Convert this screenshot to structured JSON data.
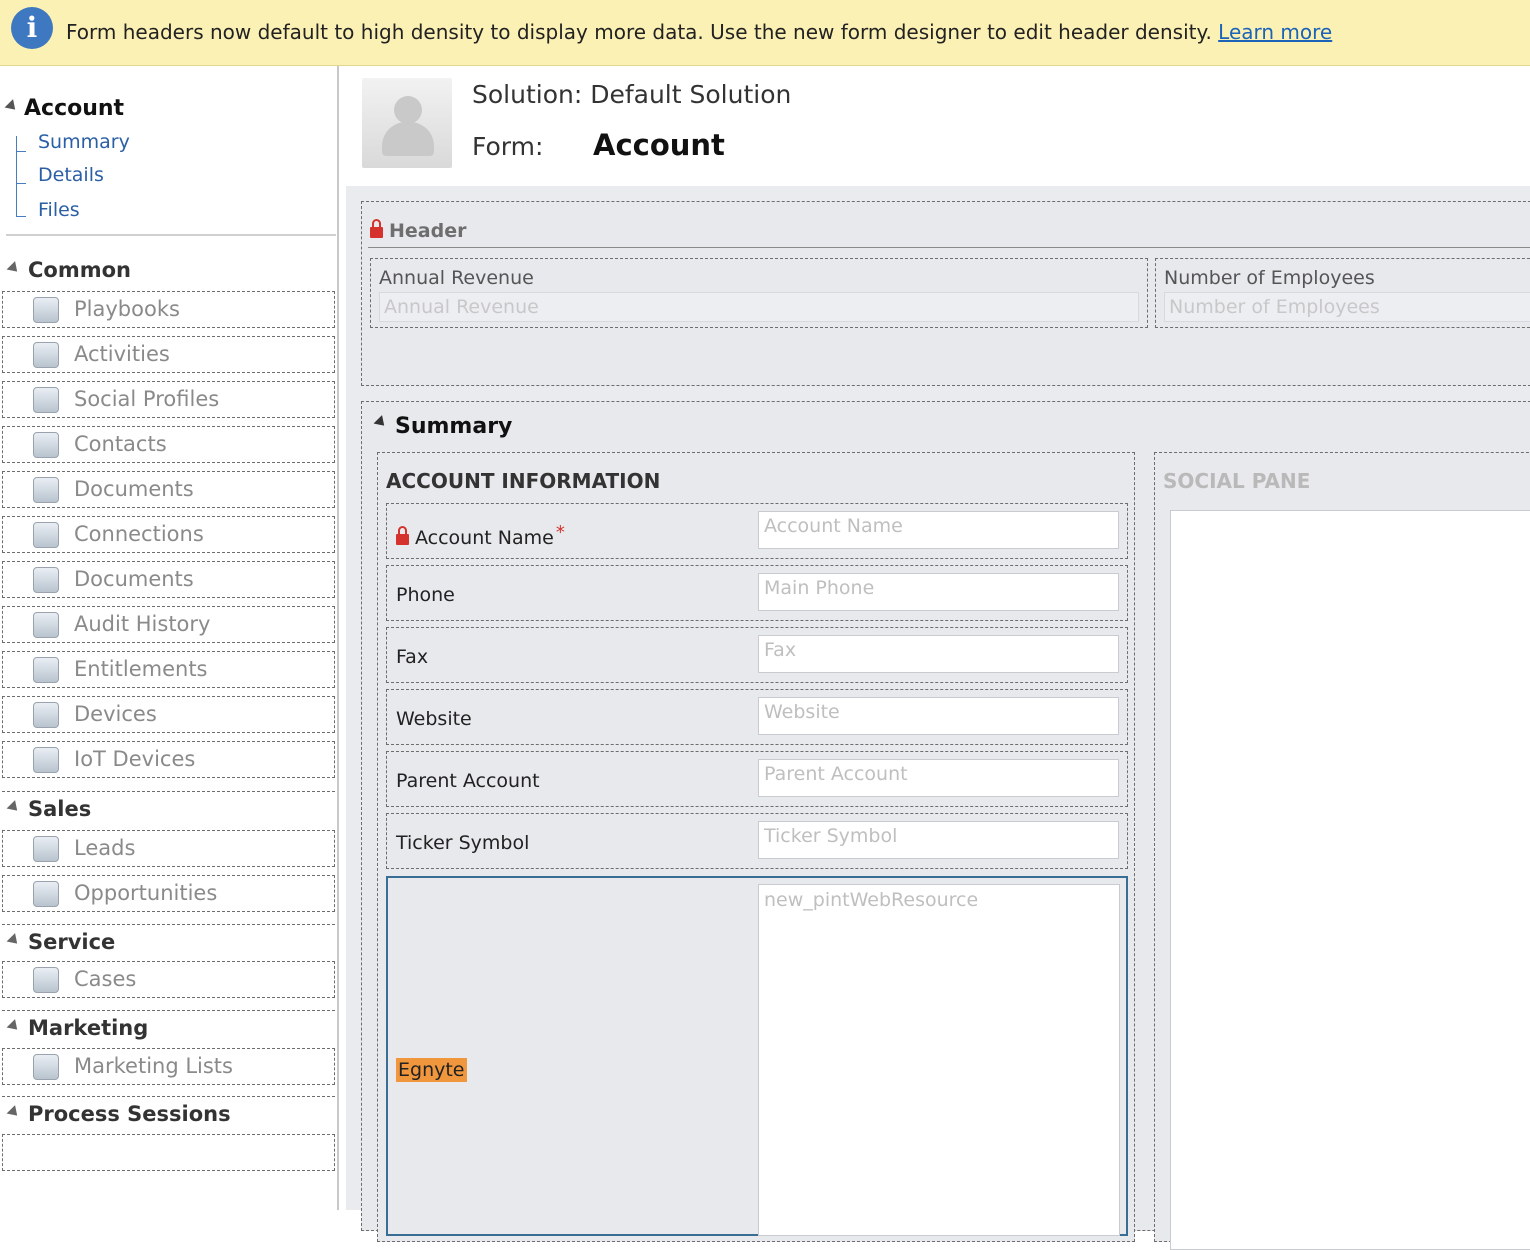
{
  "notification": {
    "message": "Form headers now default to high density to display more data. Use the new form designer to edit header density.",
    "link": "Learn more",
    "icon": "info-icon"
  },
  "sidebar": {
    "entity_title": "Account",
    "entity_links": [
      "Summary",
      "Details",
      "Files"
    ],
    "groups": [
      {
        "title": "Common",
        "items": [
          "Playbooks",
          "Activities",
          "Social Profiles",
          "Contacts",
          "Documents",
          "Connections",
          "Documents",
          "Audit History",
          "Entitlements",
          "Devices",
          "IoT Devices"
        ]
      },
      {
        "title": "Sales",
        "items": [
          "Leads",
          "Opportunities"
        ]
      },
      {
        "title": "Service",
        "items": [
          "Cases"
        ]
      },
      {
        "title": "Marketing",
        "items": [
          "Marketing Lists"
        ]
      },
      {
        "title": "Process Sessions",
        "items": []
      }
    ]
  },
  "form": {
    "solution_line": "Solution: Default Solution",
    "form_label": "Form:",
    "form_name": "Account"
  },
  "header_section": {
    "title": "Header",
    "fields": [
      {
        "label": "Annual Revenue",
        "placeholder": "Annual Revenue"
      },
      {
        "label": "Number of Employees",
        "placeholder": "Number of Employees"
      }
    ]
  },
  "summary": {
    "title": "Summary",
    "account_info_title": "ACCOUNT INFORMATION",
    "fields": [
      {
        "label": "Account Name",
        "placeholder": "Account Name",
        "required": "*"
      },
      {
        "label": "Phone",
        "placeholder": "Main Phone"
      },
      {
        "label": "Fax",
        "placeholder": "Fax"
      },
      {
        "label": "Website",
        "placeholder": "Website"
      },
      {
        "label": "Parent Account",
        "placeholder": "Parent Account"
      },
      {
        "label": "Ticker Symbol",
        "placeholder": "Ticker Symbol"
      }
    ],
    "web_resource": {
      "label": "Egnyte",
      "placeholder": "new_pintWebResource"
    },
    "social_pane_title": "SOCIAL PANE"
  },
  "colors": {
    "notification_bg": "#fcf1b4",
    "link": "#1a63b8",
    "lock": "#d5322d",
    "highlight": "#f0973e",
    "selected_border": "#3a6d93"
  }
}
